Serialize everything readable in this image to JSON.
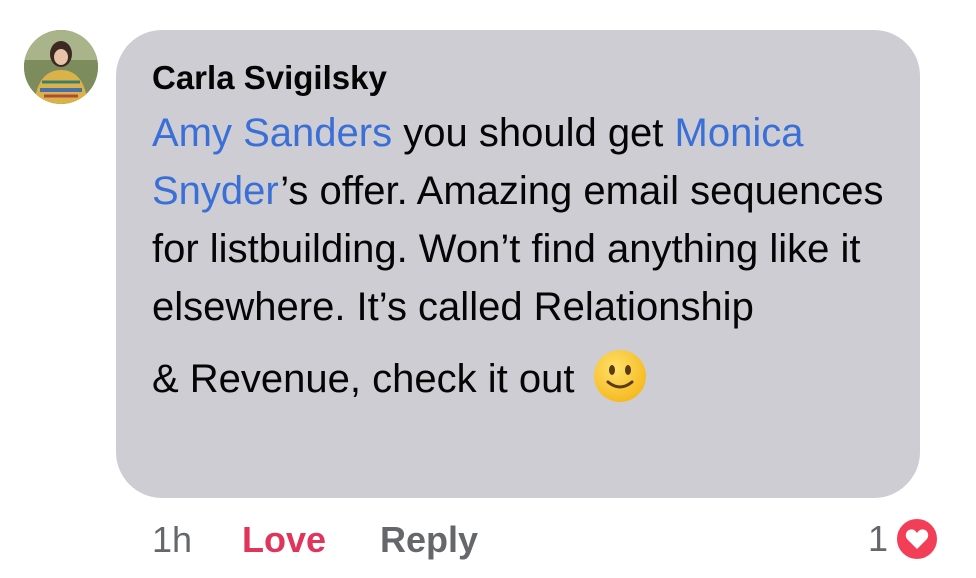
{
  "comment": {
    "author": "Carla Svigilsky",
    "avatar_icon": "profile-photo",
    "body": {
      "mention_1": "Amy Sanders",
      "text_1": " you should get ",
      "mention_2": "Monica Snyder",
      "text_2": "’s offer. Amazing email sequences for listbuilding. Won’t find anything like it elsewhere. It’s called Relationship",
      "text_3": "& Revenue, check it out",
      "emoji": "slightly-smiling-face"
    },
    "bubble_color": "#cdcdd3",
    "mention_color": "#3a6fd8"
  },
  "actions": {
    "timestamp": "1h",
    "love_label": "Love",
    "love_color": "#e0345a",
    "reply_label": "Reply"
  },
  "reactions": {
    "count": "1",
    "icon": "heart-icon",
    "color": "#f33e58"
  }
}
